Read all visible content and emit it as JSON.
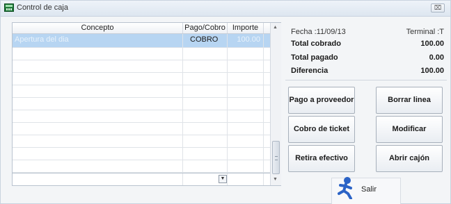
{
  "window": {
    "title": "Control de caja",
    "close_glyph": "⌧",
    "icon": "cash-register-icon"
  },
  "grid": {
    "columns": [
      "Concepto",
      "Pago/Cobro",
      "Importe"
    ],
    "rows": [
      {
        "concepto": "Apertura del dia",
        "tipo": "COBRO",
        "importe": "100.00",
        "selected": true
      }
    ],
    "empty_rows": 10
  },
  "summary": {
    "fecha": "Fecha :11/09/13",
    "terminal": "Terminal :T",
    "total_cobrado_label": "Total cobrado",
    "total_cobrado_value": "100.00",
    "total_pagado_label": "Total pagado",
    "total_pagado_value": "0.00",
    "diferencia_label": "Diferencia",
    "diferencia_value": "100.00"
  },
  "buttons": {
    "pago_proveedor": "Pago a proveedor",
    "borrar_linea": "Borrar linea",
    "cobro_ticket": "Cobro de ticket",
    "modificar": "Modificar",
    "retira_efectivo": "Retira efectivo",
    "abrir_cajon": "Abrir cajón",
    "salir": "Salir"
  },
  "colors": {
    "selected_row": "#b7d5f2",
    "salir_icon": "#2b63c6"
  }
}
